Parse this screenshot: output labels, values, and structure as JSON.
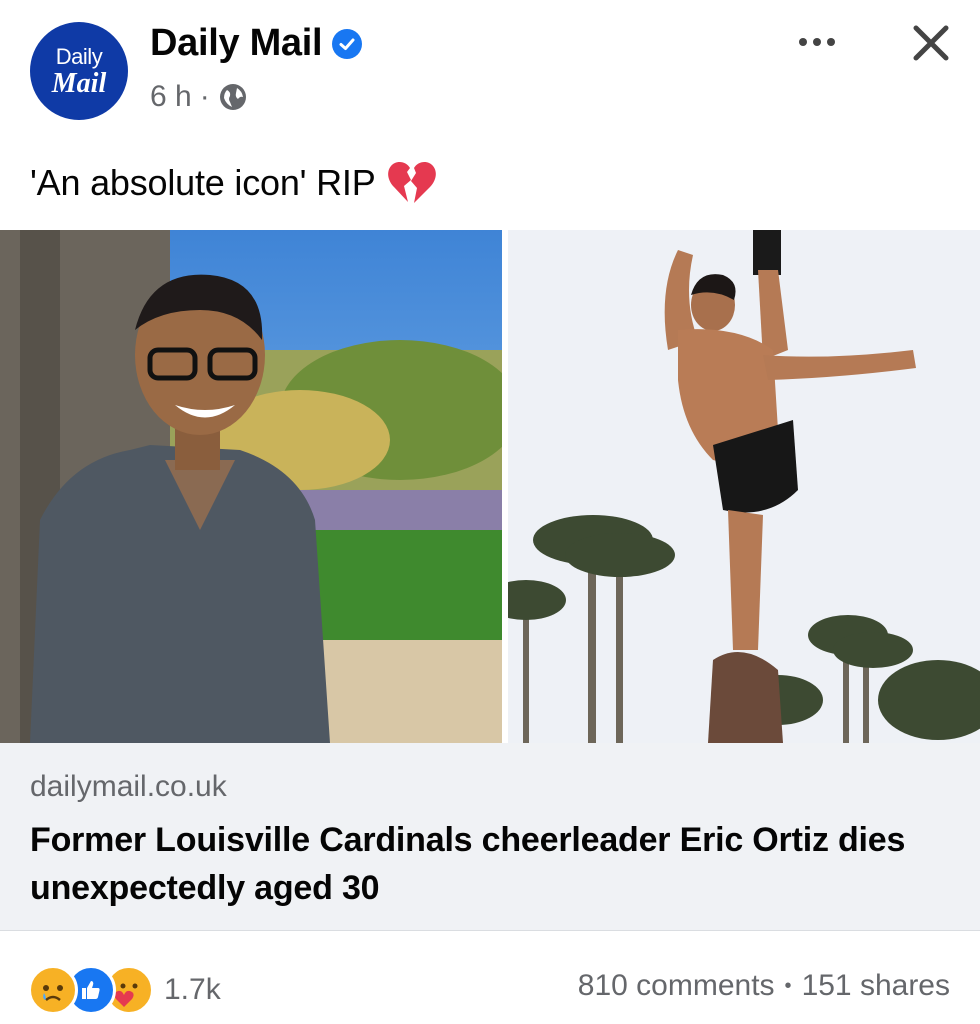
{
  "post": {
    "page_name": "Daily Mail",
    "avatar": {
      "line1": "Daily",
      "line2": "Mail"
    },
    "time": "6 h",
    "separator": "·",
    "caption": "'An absolute icon' RIP"
  },
  "link": {
    "domain": "dailymail.co.uk",
    "title": "Former Louisville Cardinals cheerleader Eric Ortiz dies unexpectedly aged 30"
  },
  "engagement": {
    "reaction_count": "1.7k",
    "comments": "810 comments",
    "dot": "•",
    "shares": "151 shares"
  },
  "icons": [
    "verified-badge-icon",
    "globe-icon",
    "more-options-icon",
    "close-icon",
    "broken-heart-icon",
    "sad-reaction-icon",
    "like-reaction-icon",
    "care-reaction-icon"
  ],
  "colors": {
    "brand": "#0f3aa6",
    "accent": "#1877f2",
    "muted": "#65676b",
    "link_bg": "#f0f2f5"
  }
}
